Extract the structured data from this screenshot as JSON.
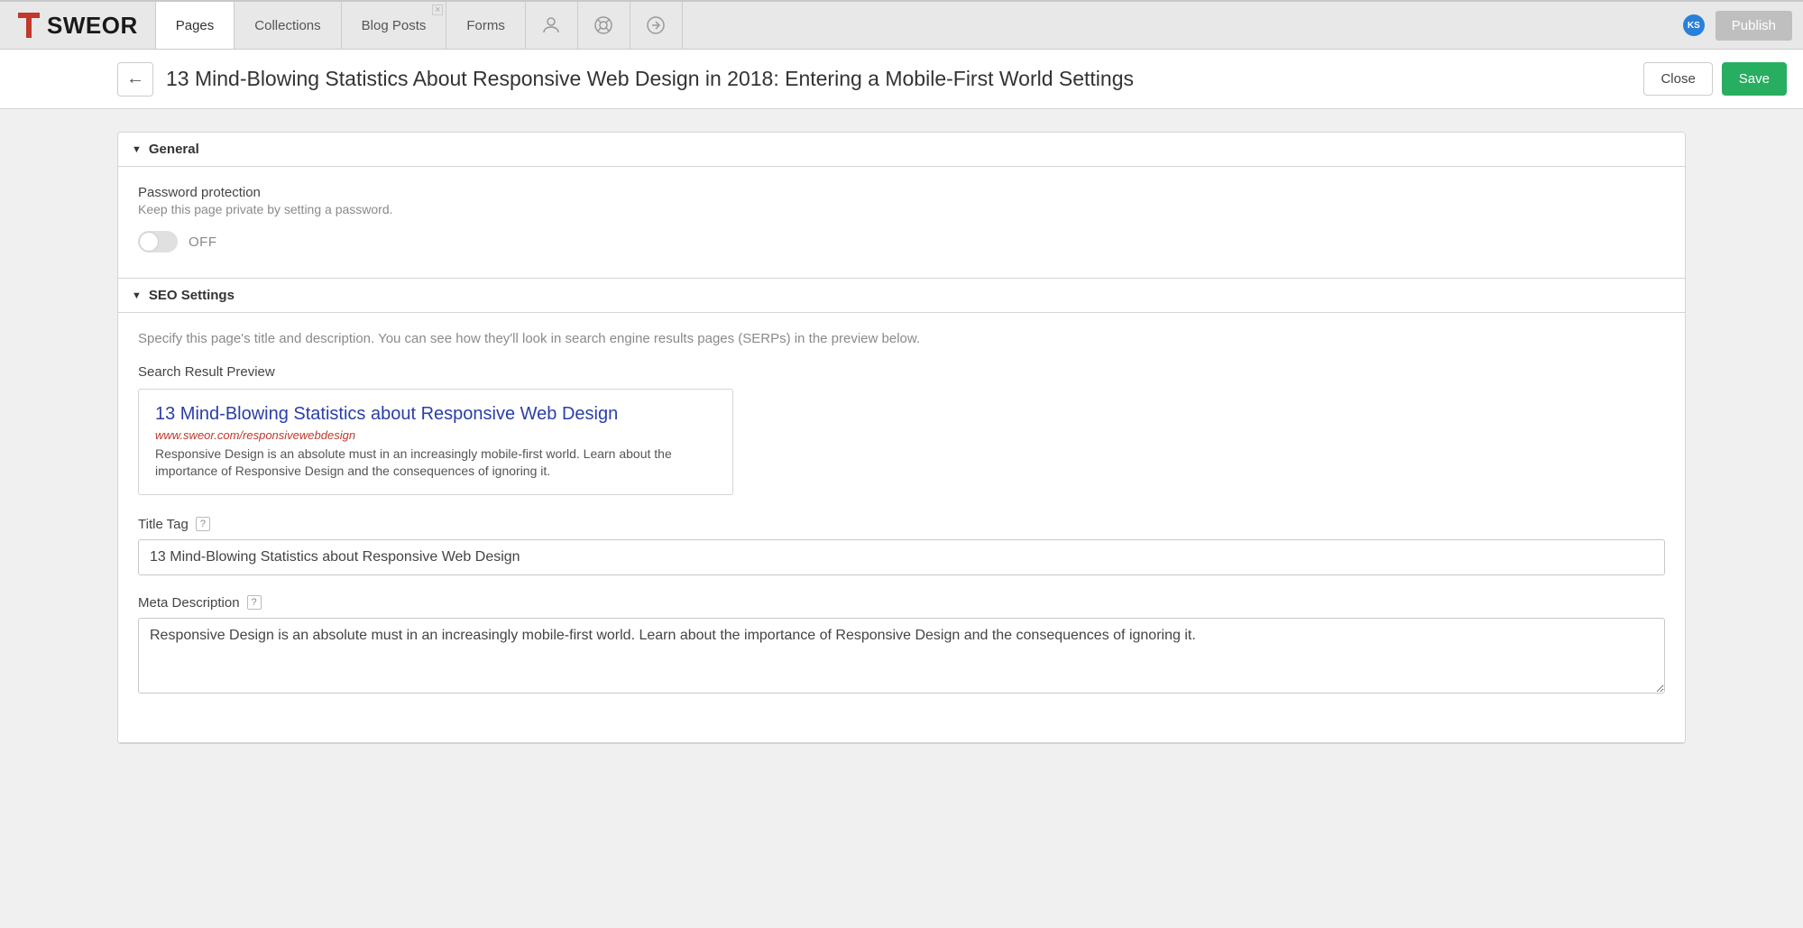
{
  "app": {
    "brand": "SWEOR"
  },
  "tabs": {
    "items": [
      {
        "label": "Pages",
        "active": true
      },
      {
        "label": "Collections",
        "active": false
      },
      {
        "label": "Blog Posts",
        "active": false,
        "closable": true
      },
      {
        "label": "Forms",
        "active": false
      }
    ]
  },
  "user": {
    "initials": "KS"
  },
  "topButtons": {
    "publish": "Publish"
  },
  "header": {
    "title": "13 Mind-Blowing Statistics About Responsive Web Design in 2018: Entering a Mobile-First World Settings",
    "close": "Close",
    "save": "Save"
  },
  "sections": {
    "general": {
      "title": "General",
      "password": {
        "label": "Password protection",
        "desc": "Keep this page private by setting a password.",
        "state": "OFF"
      }
    },
    "seo": {
      "title": "SEO Settings",
      "help": "Specify this page's title and description. You can see how they'll look in search engine results pages (SERPs) in the preview below.",
      "previewLabel": "Search Result Preview",
      "serp": {
        "title": "13 Mind-Blowing Statistics about Responsive Web Design",
        "url": "www.sweor.com/responsivewebdesign",
        "desc": "Responsive Design is an absolute must in an increasingly mobile-first world. Learn about the importance of Responsive Design and the consequences of ignoring it."
      },
      "titleTag": {
        "label": "Title Tag",
        "value": "13 Mind-Blowing Statistics about Responsive Web Design"
      },
      "metaDesc": {
        "label": "Meta Description",
        "value": "Responsive Design is an absolute must in an increasingly mobile-first world. Learn about the importance of Responsive Design and the consequences of ignoring it."
      },
      "helpBadge": "?"
    }
  }
}
